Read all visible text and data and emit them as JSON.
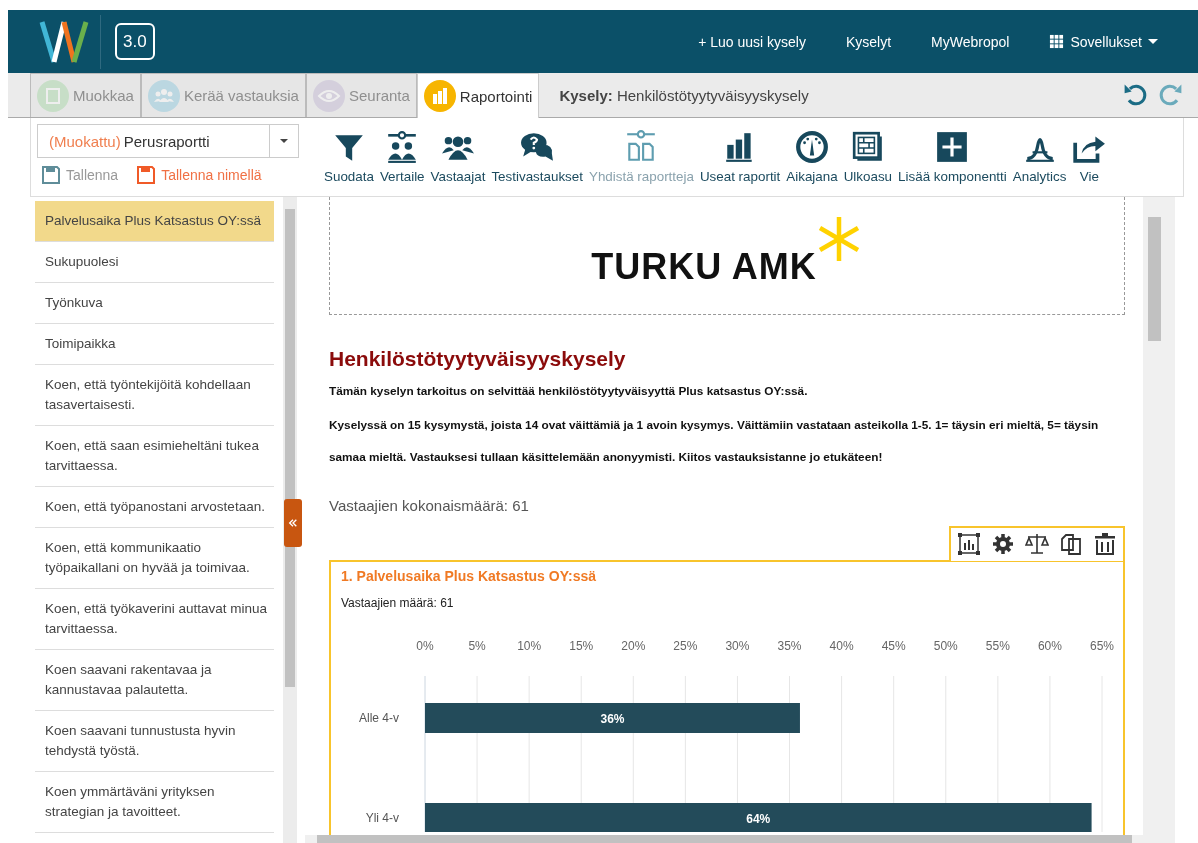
{
  "header": {
    "version": "3.0",
    "nav": [
      {
        "label": "+ Luo uusi kysely",
        "kind": "link"
      },
      {
        "label": "Kyselyt",
        "kind": "link"
      },
      {
        "label": "MyWebropol",
        "kind": "link"
      },
      {
        "label": "Sovellukset",
        "kind": "menu"
      }
    ]
  },
  "tabs": [
    {
      "label": "Muokkaa",
      "selected": false,
      "disabled": true
    },
    {
      "label": "Kerää vastauksia",
      "selected": false,
      "disabled": true
    },
    {
      "label": "Seuranta",
      "selected": false,
      "disabled": true
    },
    {
      "label": "Raportointi",
      "selected": true,
      "disabled": false
    }
  ],
  "survey_label": "**Kysely:** Henkilöstötyytyväisyyskysely",
  "report": {
    "modified": "(Muokattu)",
    "name": "Perusraportti",
    "save": [
      {
        "label": "Tallenna",
        "disabled": true
      },
      {
        "label": "Tallenna nimellä",
        "disabled": false
      }
    ]
  },
  "toolbar": [
    {
      "label": "Suodata",
      "disabled": false
    },
    {
      "label": "Vertaile",
      "disabled": false
    },
    {
      "label": "Vastaajat",
      "disabled": false
    },
    {
      "label": "Testivastaukset",
      "disabled": false
    },
    {
      "label": "Yhdistä raportteja",
      "disabled": true
    },
    {
      "label": "Useat raportit",
      "disabled": false
    },
    {
      "label": "Aikajana",
      "disabled": false
    },
    {
      "label": "Ulkoasu",
      "disabled": false
    },
    {
      "label": "Lisää komponentti",
      "disabled": false
    },
    {
      "label": "Analytics",
      "disabled": false
    },
    {
      "label": "Vie",
      "disabled": false
    }
  ],
  "sidebar": {
    "items": [
      {
        "label": "Palvelusaika Plus Katsastus OY:ssä",
        "selected": true
      },
      {
        "label": "Sukupuolesi",
        "selected": false
      },
      {
        "label": "Työnkuva",
        "selected": false
      },
      {
        "label": "Toimipaikka",
        "selected": false
      },
      {
        "label": "Koen, että työntekijöitä kohdellaan tasavertaisesti.",
        "selected": false
      },
      {
        "label": "Koen, että saan esimieheltäni tukea tarvittaessa.",
        "selected": false
      },
      {
        "label": "Koen, että työpanostani arvostetaan.",
        "selected": false
      },
      {
        "label": "Koen, että kommunikaatio työpaikallani on hyvää ja toimivaa.",
        "selected": false
      },
      {
        "label": "Koen, että työkaverini auttavat minua tarvittaessa.",
        "selected": false
      },
      {
        "label": "Koen saavani rakentavaa ja kannustavaa palautetta.",
        "selected": false
      },
      {
        "label": "Koen saavani tunnustusta hyvin tehdystä työstä.",
        "selected": false
      },
      {
        "label": "Koen ymmärtäväni yrityksen strategian ja tavoitteet.",
        "selected": false
      }
    ]
  },
  "report_content": {
    "logo_text": "TURKU AMK",
    "title": "Henkilöstötyytyväisyyskysely",
    "paragraphs": [
      "Tämän kyselyn tarkoitus on selvittää henkilöstötyytyväisyyttä Plus katsastus OY:ssä.",
      "Kyselyssä on 15 kysymystä, joista 14 ovat väittämiä ja 1 avoin kysymys. Väittämiin vastataan asteikolla 1-5. 1= täysin eri mieltä, 5= täysin samaa mieltä. Vastauksesi tullaan käsittelemään anonyymisti. Kiitos vastauksistanne jo etukäteen!"
    ],
    "total": "Vastaajien kokonaismäärä: 61",
    "questions": [
      {
        "title": "1. Palvelusaika Plus Katsastus OY:ssä",
        "respondents": "Vastaajien määrä: 61",
        "chart_data": {
          "type": "bar",
          "orientation": "horizontal",
          "categories": [
            "Alle 4-v",
            "Yli 4-v"
          ],
          "values": [
            36,
            64
          ],
          "xlim": [
            0,
            65
          ],
          "value_labels": [
            "36%",
            "64%"
          ],
          "grid": true,
          "xticks": [
            {
              "value": 0,
              "label": "0%"
            },
            {
              "value": 5,
              "label": "5%"
            },
            {
              "value": 10,
              "label": "10%"
            },
            {
              "value": 15,
              "label": "15%"
            },
            {
              "value": 20,
              "label": "20%"
            },
            {
              "value": 25,
              "label": "25%"
            },
            {
              "value": 30,
              "label": "30%"
            },
            {
              "value": 35,
              "label": "35%"
            },
            {
              "value": 40,
              "label": "40%"
            },
            {
              "value": 45,
              "label": "45%"
            },
            {
              "value": 50,
              "label": "50%"
            },
            {
              "value": 55,
              "label": "55%"
            },
            {
              "value": 60,
              "label": "60%"
            },
            {
              "value": 65,
              "label": "65%"
            }
          ]
        }
      }
    ]
  }
}
